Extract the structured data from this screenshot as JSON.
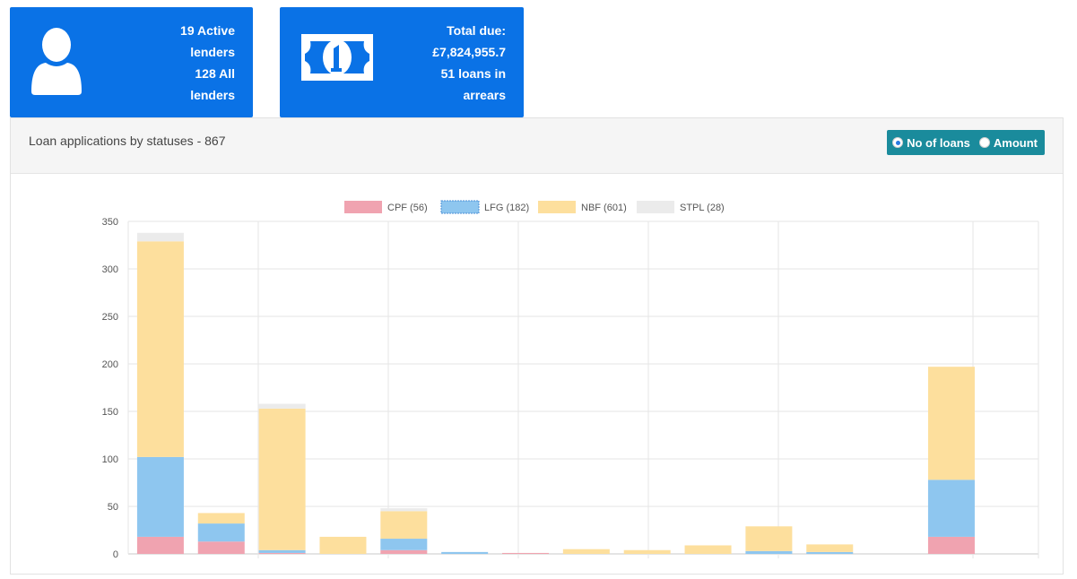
{
  "cards": {
    "lenders": {
      "icon": "user-icon",
      "line1": "19 Active",
      "line2": "lenders",
      "line3": "128 All",
      "line4": "lenders"
    },
    "due": {
      "icon": "banknote-icon",
      "line1": "Total due:",
      "line2": "£7,824,955.7",
      "line3": "51 loans in",
      "line4": "arrears"
    }
  },
  "panel": {
    "title": "Loan applications by statuses - 867",
    "toggle": {
      "option1": "No of loans",
      "option2": "Amount",
      "selected": "No of loans"
    }
  },
  "colors": {
    "accent": "#0a72e6",
    "toggle_bg": "#1a8b9c",
    "cpf": "#f0a3b0",
    "lfg": "#8ec6ef",
    "nbf": "#fddf9d",
    "stpl": "#ebebeb"
  },
  "chart_data": {
    "type": "bar",
    "stacked": true,
    "ylim": [
      0,
      350
    ],
    "yticks": [
      0,
      50,
      100,
      150,
      200,
      250,
      300,
      350
    ],
    "grid": true,
    "legend_position": "top",
    "categories": [
      "",
      "",
      "",
      "",
      "",
      "",
      "",
      "",
      "",
      "",
      "",
      "",
      "",
      "",
      ""
    ],
    "series": [
      {
        "name": "CPF (56)",
        "color": "#f0a3b0",
        "values": [
          18,
          13,
          1,
          0,
          4,
          0,
          1,
          0,
          0,
          0,
          0,
          0,
          0,
          18,
          0
        ]
      },
      {
        "name": "LFG (182)",
        "color": "#8ec6ef",
        "values": [
          84,
          19,
          3,
          0,
          12,
          2,
          0,
          0,
          0,
          0,
          3,
          2,
          0,
          60,
          0
        ]
      },
      {
        "name": "NBF (601)",
        "color": "#fddf9d",
        "values": [
          227,
          11,
          149,
          18,
          29,
          0,
          0,
          5,
          4,
          9,
          26,
          8,
          0,
          119,
          0
        ]
      },
      {
        "name": "STPL (28)",
        "color": "#ebebeb",
        "values": [
          9,
          0,
          5,
          0,
          3,
          0,
          0,
          0,
          0,
          0,
          0,
          0,
          0,
          0,
          0
        ]
      }
    ]
  }
}
